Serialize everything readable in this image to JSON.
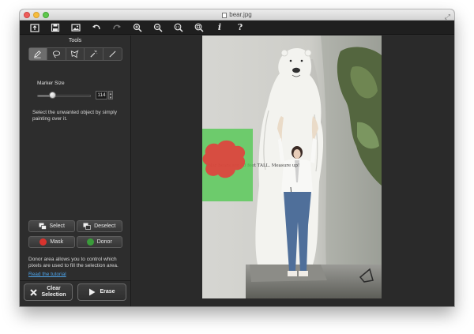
{
  "window": {
    "title": "bear.jpg"
  },
  "toolbar": {
    "buttons": [
      {
        "icon": "open-icon"
      },
      {
        "icon": "save-icon"
      },
      {
        "icon": "image-icon"
      },
      {
        "icon": "undo-icon"
      },
      {
        "icon": "redo-icon"
      },
      {
        "icon": "zoom-in-icon"
      },
      {
        "icon": "zoom-out-icon"
      },
      {
        "icon": "zoom-actual-size-icon",
        "label": "1:1"
      },
      {
        "icon": "zoom-fit-icon"
      },
      {
        "icon": "info-icon",
        "label": "i"
      },
      {
        "icon": "help-icon",
        "label": "?"
      }
    ]
  },
  "tools": {
    "title": "Tools",
    "items": [
      {
        "icon": "marker-icon",
        "active": true
      },
      {
        "icon": "lasso-icon",
        "active": false
      },
      {
        "icon": "polygon-lasso-icon",
        "active": false
      },
      {
        "icon": "magic-wand-icon",
        "active": false
      },
      {
        "icon": "line-icon",
        "active": false
      }
    ]
  },
  "marker": {
    "label": "Marker Size",
    "value": "114",
    "slider_fraction": 0.28
  },
  "instruction": "Select the unwanted object by simply painting over it.",
  "selection": {
    "select_label": "Select",
    "deselect_label": "Deselect"
  },
  "mask": {
    "mask_label": "Mask",
    "donor_label": "Donor",
    "mask_color": "#d9332e",
    "donor_color": "#3a9c3a"
  },
  "donor_text": "Donor area allows you to control which pixels are used to fill the selection area.",
  "tutorial_link": "Read the tutorial",
  "actions": {
    "clear_label_1": "Clear",
    "clear_label_2": "Selection",
    "erase_label": "Erase"
  },
  "canvas": {
    "image_name": "bear.jpg",
    "sign_text": "Polar bears are 10 feet TALL. Measure up!",
    "mask_overlay_color": "#e63b3b",
    "donor_overlay_color": "#4fc24f"
  }
}
